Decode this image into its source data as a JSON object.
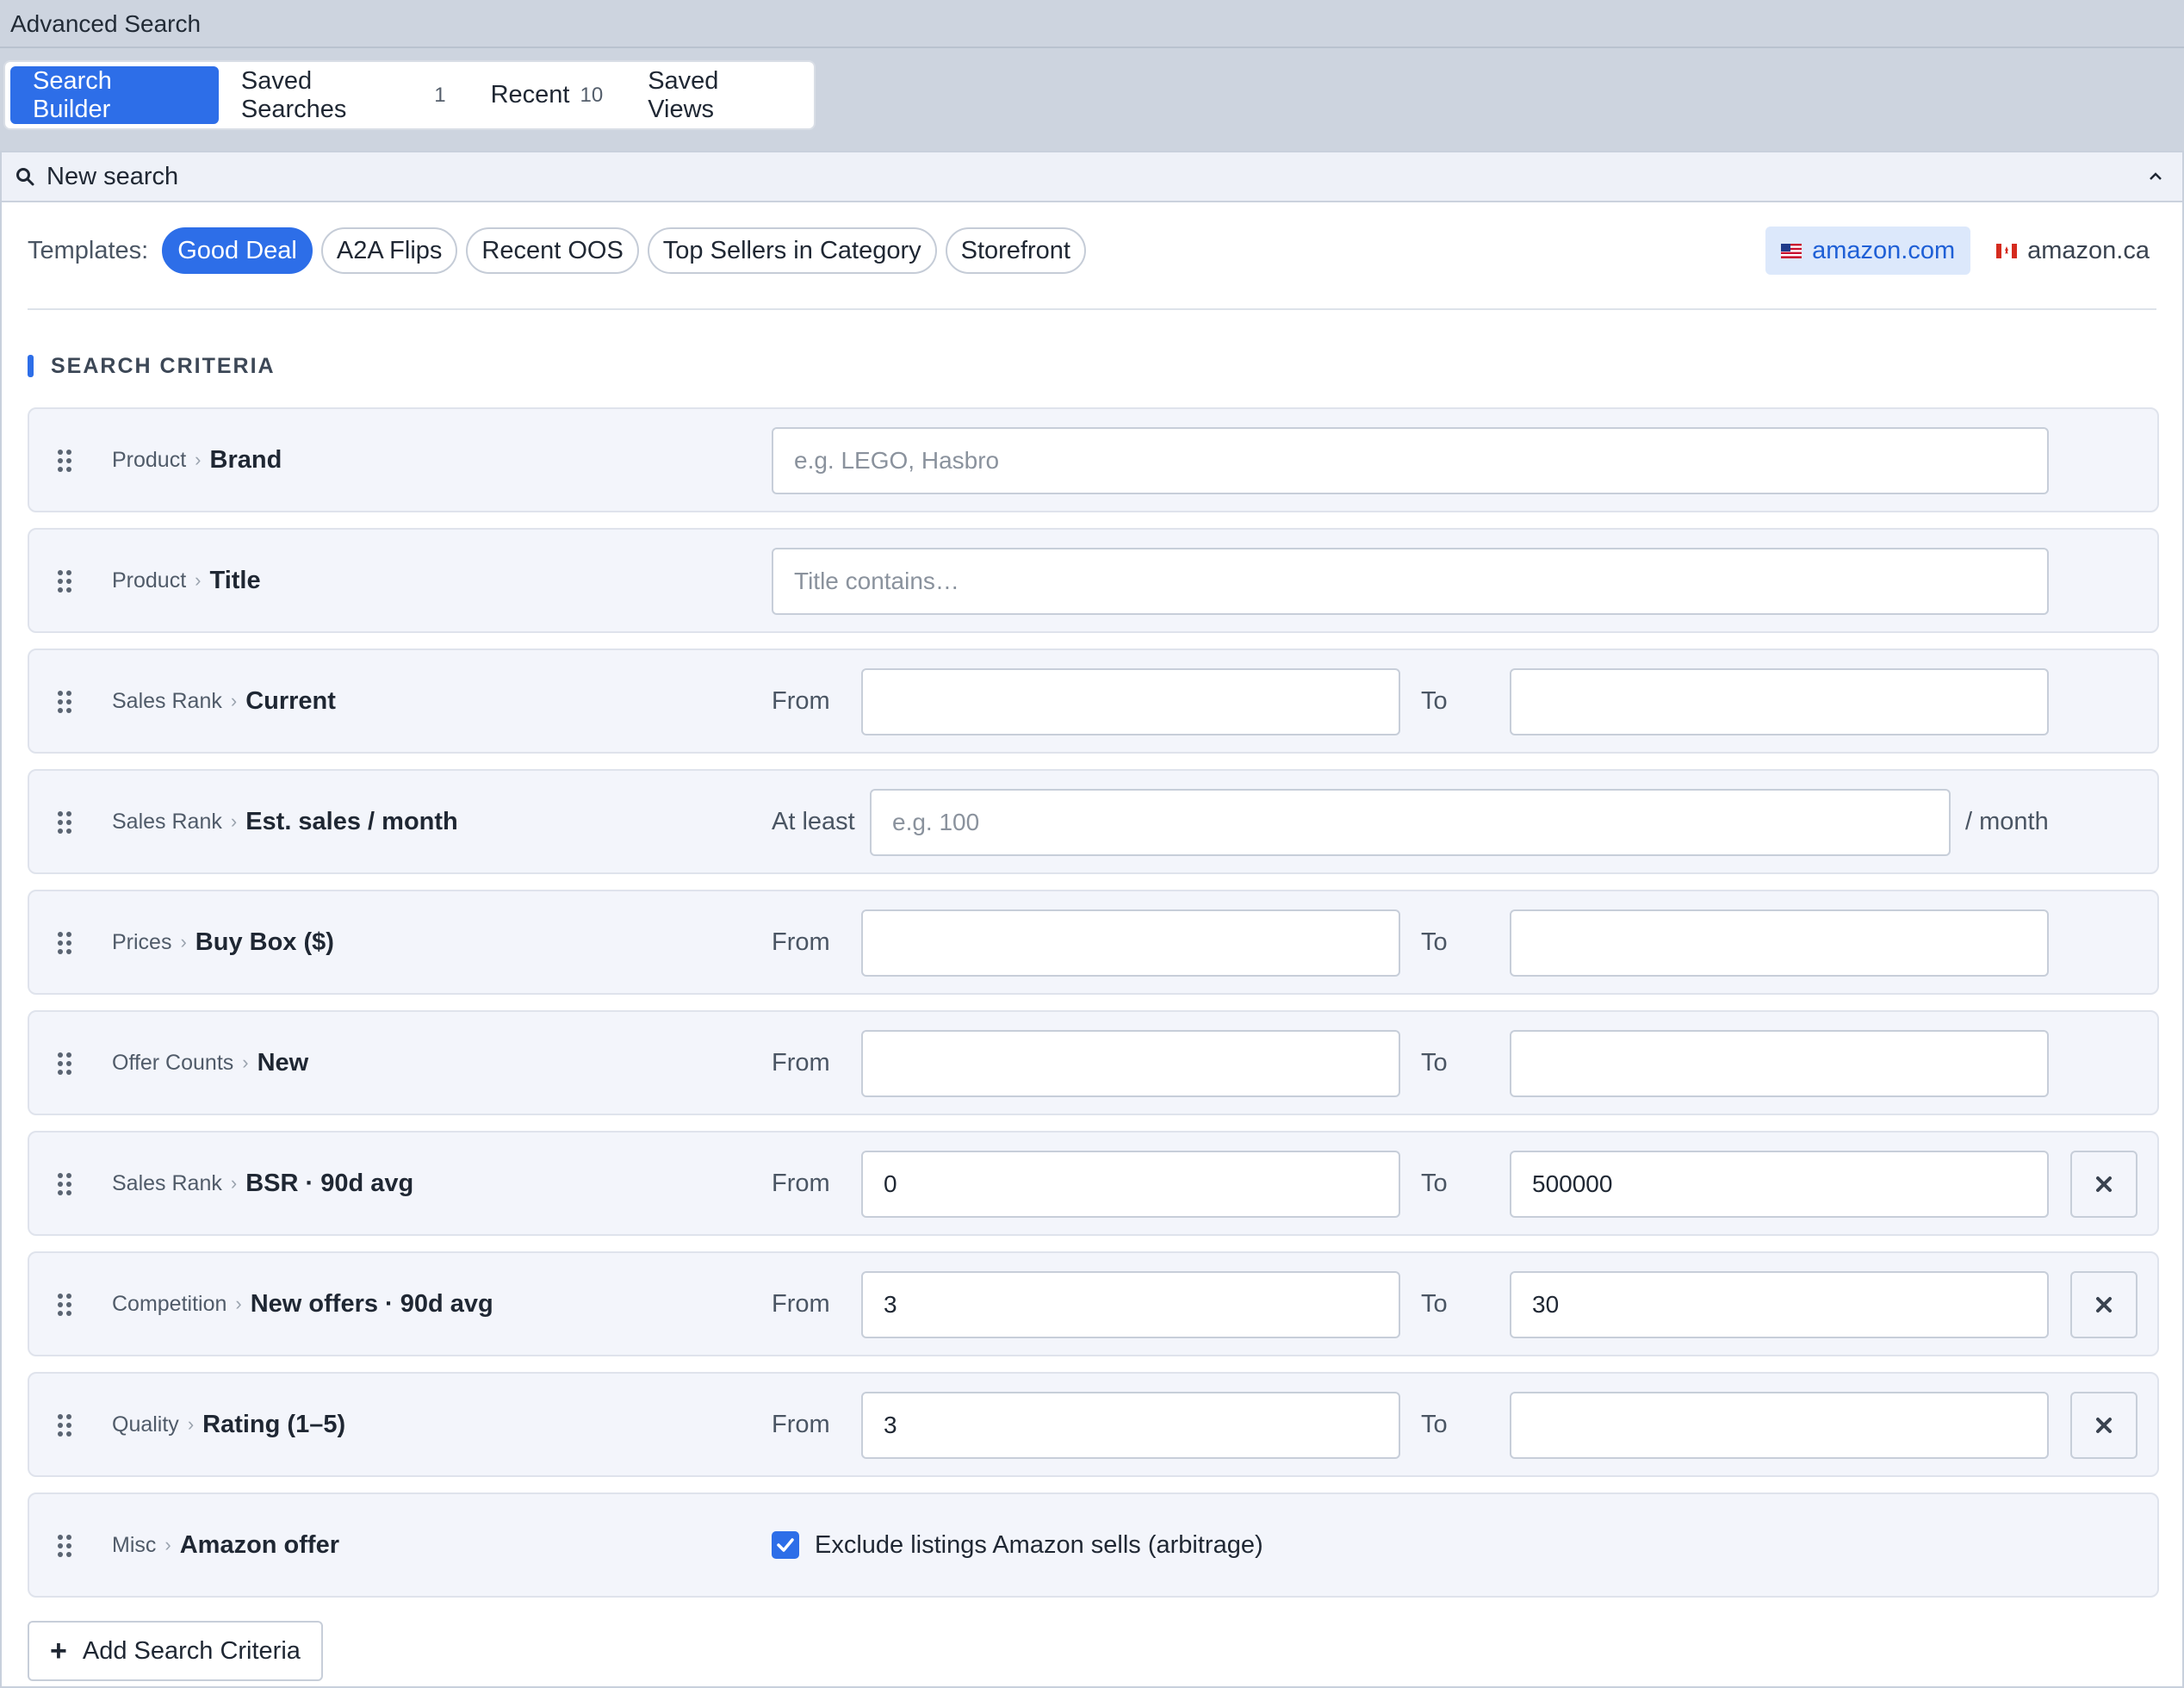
{
  "window": {
    "title": "Advanced Search"
  },
  "tabs": [
    {
      "label": "Search Builder",
      "count": ""
    },
    {
      "label": "Saved Searches",
      "count": "1"
    },
    {
      "label": "Recent",
      "count": "10"
    },
    {
      "label": "Saved Views",
      "count": ""
    }
  ],
  "panel": {
    "title": "New search",
    "collapse_icon": "chevron-up-icon",
    "search_icon": "search-icon"
  },
  "templates": {
    "label": "Templates:",
    "items": [
      "Good Deal",
      "A2A Flips",
      "Recent OOS",
      "Top Sellers in Category",
      "Storefront"
    ],
    "active": "Good Deal"
  },
  "markets": [
    {
      "label": "amazon.com",
      "flag": "us-flag-icon",
      "active": true
    },
    {
      "label": "amazon.ca",
      "flag": "ca-flag-icon",
      "active": false
    }
  ],
  "section_title": "SEARCH CRITERIA",
  "labels": {
    "from": "From",
    "to": "To",
    "at_least": "At least",
    "per_month": "/ month"
  },
  "criteria": [
    {
      "category": "Product",
      "field": "Brand",
      "placeholder": "e.g. LEGO, Hasbro",
      "value": ""
    },
    {
      "category": "Product",
      "field": "Title",
      "placeholder": "Title contains…",
      "value": ""
    },
    {
      "category": "Sales Rank",
      "field": "Current",
      "from": "",
      "to": ""
    },
    {
      "category": "Sales Rank",
      "field": "Est. sales / month",
      "placeholder": "e.g. 100",
      "value": ""
    },
    {
      "category": "Prices",
      "field": "Buy Box ($)",
      "from": "",
      "to": ""
    },
    {
      "category": "Offer Counts",
      "field": "New",
      "from": "",
      "to": ""
    },
    {
      "category": "Sales Rank",
      "field": "BSR · 90d avg",
      "from": "0",
      "to": "500000"
    },
    {
      "category": "Competition",
      "field": "New offers · 90d avg",
      "from": "3",
      "to": "30"
    },
    {
      "category": "Quality",
      "field": "Rating (1–5)",
      "from": "3",
      "to": ""
    },
    {
      "category": "Misc",
      "field": "Amazon offer",
      "checkbox_label": "Exclude listings Amazon sells (arbitrage)",
      "checked": true
    }
  ],
  "add_button": "Add Search Criteria",
  "colors": {
    "accent": "#2d6ee8",
    "background": "#cdd4df",
    "row_bg": "#f3f5fb"
  }
}
